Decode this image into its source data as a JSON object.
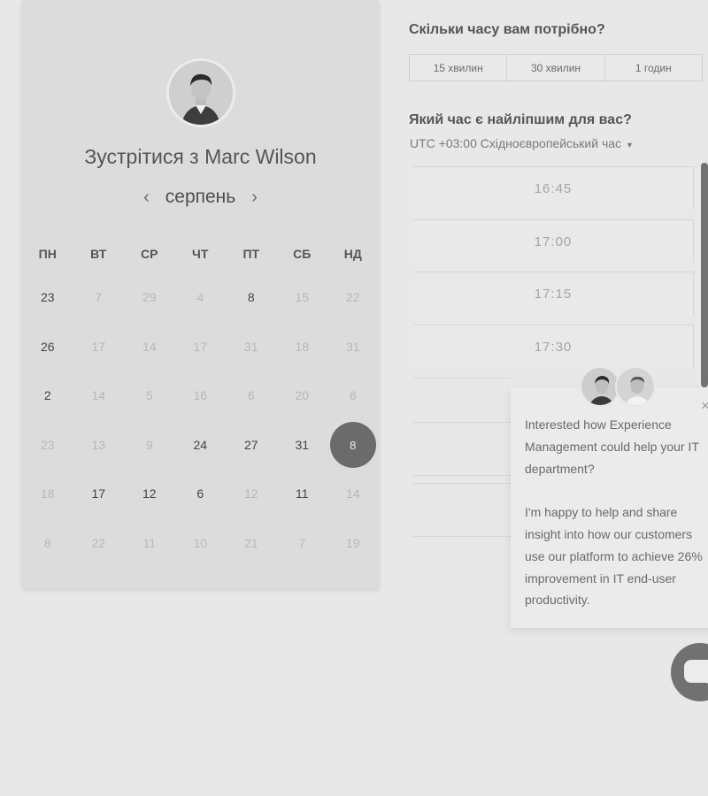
{
  "booking": {
    "title": "Зустрітися з Marc Wilson",
    "month": "серпень",
    "prev_icon": "‹",
    "next_icon": "›",
    "weekdays": [
      "ПН",
      "ВТ",
      "СР",
      "ЧТ",
      "ПТ",
      "СБ",
      "НД"
    ],
    "weeks": [
      [
        "23",
        "7",
        "29",
        "4",
        "8",
        "15",
        "22"
      ],
      [
        "26",
        "17",
        "14",
        "17",
        "31",
        "18",
        "31"
      ],
      [
        "2",
        "14",
        "5",
        "16",
        "6",
        "20",
        "6"
      ],
      [
        "23",
        "13",
        "9",
        "24",
        "27",
        "31",
        "8"
      ],
      [
        "18",
        "17",
        "12",
        "6",
        "12",
        "11",
        "14"
      ],
      [
        "8",
        "22",
        "11",
        "10",
        "21",
        "7",
        "19"
      ]
    ],
    "selected_day": "8"
  },
  "duration": {
    "question": "Скільки часу вам потрібно?",
    "options": [
      "15 хвилин",
      "30 хвилин",
      "1 годин"
    ]
  },
  "time": {
    "question": "Який час є найліпшим для вас?",
    "timezone": "UTC +03:00 Східноєвропейський час",
    "caret": "▼",
    "slots": [
      "16:45",
      "17:00",
      "17:15",
      "17:30"
    ]
  },
  "chat": {
    "message_1": "Interested how Experience Management could help your IT department?",
    "message_2": "I'm happy to help and share insight into how our customers use our platform to achieve 26% improvement in IT end-user productivity.",
    "close_icon": "×"
  },
  "colors": {
    "background": "#e8e8e8",
    "card": "#dcdcdc",
    "selected_day": "#6b6b6b",
    "launcher": "#717171"
  }
}
